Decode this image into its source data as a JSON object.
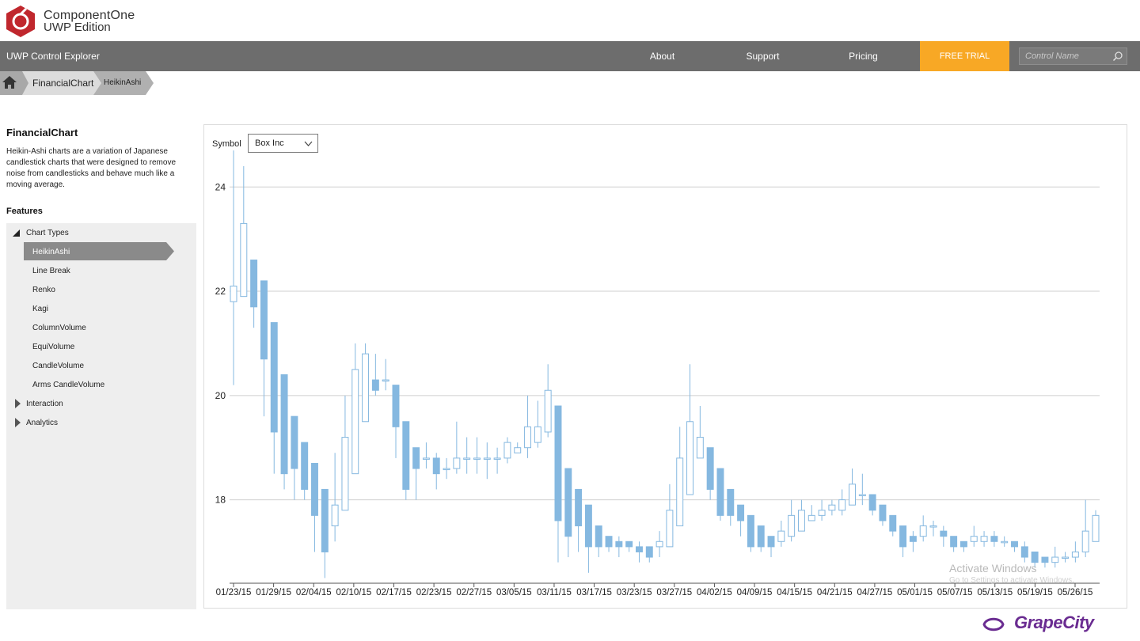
{
  "brand": {
    "line1": "ComponentOne",
    "line2": "UWP Edition",
    "color": "#c0272d"
  },
  "nav": {
    "title": "UWP Control Explorer",
    "links": [
      "About",
      "Support",
      "Pricing"
    ],
    "trial": "FREE TRIAL",
    "search_placeholder": "Control Name",
    "accent": "#f8a825"
  },
  "breadcrumb": {
    "items": [
      "FinancialChart",
      "HeikinAshi"
    ]
  },
  "sidebar": {
    "title": "FinancialChart",
    "description": "Heikin-Ashi charts are a variation of Japanese candlestick charts that were designed to remove noise from candlesticks and behave much like a moving average.",
    "features_label": "Features",
    "groups": [
      {
        "label": "Chart Types",
        "expanded": true,
        "items": [
          "HeikinAshi",
          "Line Break",
          "Renko",
          "Kagi",
          "ColumnVolume",
          "EquiVolume",
          "CandleVolume",
          "Arms CandleVolume"
        ]
      },
      {
        "label": "Interaction",
        "expanded": false
      },
      {
        "label": "Analytics",
        "expanded": false
      }
    ]
  },
  "symbol": {
    "label": "Symbol",
    "value": "Box Inc"
  },
  "watermark": {
    "line1": "Activate Windows",
    "line2": "Go to Settings to activate Windows."
  },
  "footer": {
    "logo_text": "GrapeCity"
  },
  "chart_data": {
    "type": "heikin-ashi candlestick",
    "y_ticks": [
      18,
      20,
      22,
      24
    ],
    "ylim": [
      16.4,
      24.9
    ],
    "grid": "horizontal",
    "x_tick_labels": [
      "01/23/15",
      "01/29/15",
      "02/04/15",
      "02/10/15",
      "02/17/15",
      "02/23/15",
      "02/27/15",
      "03/05/15",
      "03/11/15",
      "03/17/15",
      "03/23/15",
      "03/27/15",
      "04/02/15",
      "04/09/15",
      "04/15/15",
      "04/21/15",
      "04/27/15",
      "05/01/15",
      "05/07/15",
      "05/13/15",
      "05/19/15",
      "05/26/15"
    ],
    "bullish_color": "#ffffff",
    "bearish_color": "#85b8e0",
    "outline_color": "#85b8e0",
    "candles": [
      [
        21.8,
        22.1,
        24.7,
        20.2
      ],
      [
        21.9,
        23.3,
        24.4,
        21.9
      ],
      [
        22.6,
        21.7,
        22.6,
        21.3
      ],
      [
        22.2,
        20.7,
        22.2,
        19.6
      ],
      [
        21.4,
        19.3,
        21.4,
        18.5
      ],
      [
        20.4,
        18.5,
        20.4,
        18.2
      ],
      [
        19.6,
        18.6,
        19.6,
        18.0
      ],
      [
        19.1,
        18.2,
        19.1,
        18.0
      ],
      [
        18.7,
        17.7,
        18.7,
        17.0
      ],
      [
        18.2,
        17.0,
        18.2,
        16.5
      ],
      [
        17.5,
        17.9,
        18.9,
        17.2
      ],
      [
        17.8,
        19.2,
        20.0,
        17.8
      ],
      [
        18.5,
        20.5,
        21.0,
        18.5
      ],
      [
        19.5,
        20.8,
        21.0,
        19.5
      ],
      [
        20.3,
        20.1,
        20.8,
        20.0
      ],
      [
        20.3,
        20.3,
        20.7,
        20.1
      ],
      [
        20.2,
        19.4,
        20.2,
        18.8
      ],
      [
        19.5,
        18.2,
        19.5,
        18.0
      ],
      [
        19.0,
        18.6,
        19.0,
        18.0
      ],
      [
        18.8,
        18.8,
        19.1,
        18.6
      ],
      [
        18.8,
        18.5,
        18.9,
        18.2
      ],
      [
        18.6,
        18.6,
        18.8,
        18.4
      ],
      [
        18.6,
        18.8,
        19.5,
        18.5
      ],
      [
        18.8,
        18.8,
        19.2,
        18.5
      ],
      [
        18.8,
        18.8,
        19.2,
        18.5
      ],
      [
        18.8,
        18.8,
        19.1,
        18.4
      ],
      [
        18.8,
        18.8,
        19.0,
        18.5
      ],
      [
        18.8,
        19.1,
        19.2,
        18.7
      ],
      [
        18.9,
        19.0,
        19.1,
        18.9
      ],
      [
        19.0,
        19.4,
        20.0,
        18.8
      ],
      [
        19.1,
        19.4,
        19.9,
        19.0
      ],
      [
        19.3,
        20.1,
        20.6,
        19.2
      ],
      [
        19.8,
        17.6,
        19.8,
        16.8
      ],
      [
        18.6,
        17.3,
        18.6,
        16.9
      ],
      [
        18.2,
        17.5,
        18.2,
        17.0
      ],
      [
        17.9,
        17.1,
        17.9,
        16.6
      ],
      [
        17.5,
        17.1,
        17.5,
        16.9
      ],
      [
        17.3,
        17.1,
        17.3,
        17.0
      ],
      [
        17.2,
        17.1,
        17.3,
        16.9
      ],
      [
        17.2,
        17.1,
        17.2,
        17.0
      ],
      [
        17.1,
        17.0,
        17.2,
        16.8
      ],
      [
        17.1,
        16.9,
        17.1,
        16.8
      ],
      [
        17.1,
        17.2,
        17.4,
        16.9
      ],
      [
        17.1,
        17.8,
        18.3,
        17.1
      ],
      [
        17.5,
        18.8,
        19.4,
        17.5
      ],
      [
        18.1,
        19.5,
        20.6,
        18.1
      ],
      [
        18.8,
        19.2,
        19.8,
        18.8
      ],
      [
        19.0,
        18.2,
        19.0,
        18.0
      ],
      [
        18.6,
        17.7,
        18.6,
        17.6
      ],
      [
        18.2,
        17.7,
        18.2,
        17.5
      ],
      [
        17.9,
        17.6,
        17.9,
        17.3
      ],
      [
        17.7,
        17.1,
        17.7,
        17.0
      ],
      [
        17.5,
        17.1,
        17.5,
        17.0
      ],
      [
        17.3,
        17.1,
        17.3,
        16.9
      ],
      [
        17.2,
        17.4,
        17.6,
        17.1
      ],
      [
        17.3,
        17.7,
        18.0,
        17.2
      ],
      [
        17.4,
        17.8,
        18.0,
        17.4
      ],
      [
        17.6,
        17.7,
        17.9,
        17.6
      ],
      [
        17.7,
        17.8,
        18.0,
        17.6
      ],
      [
        17.8,
        17.9,
        18.0,
        17.7
      ],
      [
        17.8,
        18.0,
        18.2,
        17.7
      ],
      [
        17.9,
        18.3,
        18.6,
        17.9
      ],
      [
        18.1,
        18.1,
        18.5,
        17.9
      ],
      [
        18.1,
        17.8,
        18.1,
        17.7
      ],
      [
        17.9,
        17.6,
        17.9,
        17.5
      ],
      [
        17.7,
        17.4,
        17.7,
        17.3
      ],
      [
        17.5,
        17.1,
        17.5,
        16.9
      ],
      [
        17.3,
        17.2,
        17.4,
        17.0
      ],
      [
        17.3,
        17.5,
        17.7,
        17.2
      ],
      [
        17.5,
        17.5,
        17.6,
        17.3
      ],
      [
        17.4,
        17.3,
        17.5,
        17.1
      ],
      [
        17.3,
        17.1,
        17.3,
        17.0
      ],
      [
        17.2,
        17.1,
        17.2,
        17.0
      ],
      [
        17.2,
        17.3,
        17.5,
        17.1
      ],
      [
        17.2,
        17.3,
        17.4,
        17.1
      ],
      [
        17.3,
        17.2,
        17.4,
        17.1
      ],
      [
        17.2,
        17.2,
        17.3,
        17.1
      ],
      [
        17.2,
        17.1,
        17.2,
        17.0
      ],
      [
        17.1,
        16.9,
        17.2,
        16.8
      ],
      [
        17.0,
        16.8,
        17.0,
        16.7
      ],
      [
        16.9,
        16.8,
        16.9,
        16.7
      ],
      [
        16.8,
        16.9,
        17.1,
        16.7
      ],
      [
        16.9,
        16.9,
        17.0,
        16.8
      ],
      [
        16.9,
        17.0,
        17.2,
        16.8
      ],
      [
        17.0,
        17.4,
        18.0,
        16.9
      ],
      [
        17.2,
        17.7,
        17.8,
        17.2
      ]
    ]
  }
}
